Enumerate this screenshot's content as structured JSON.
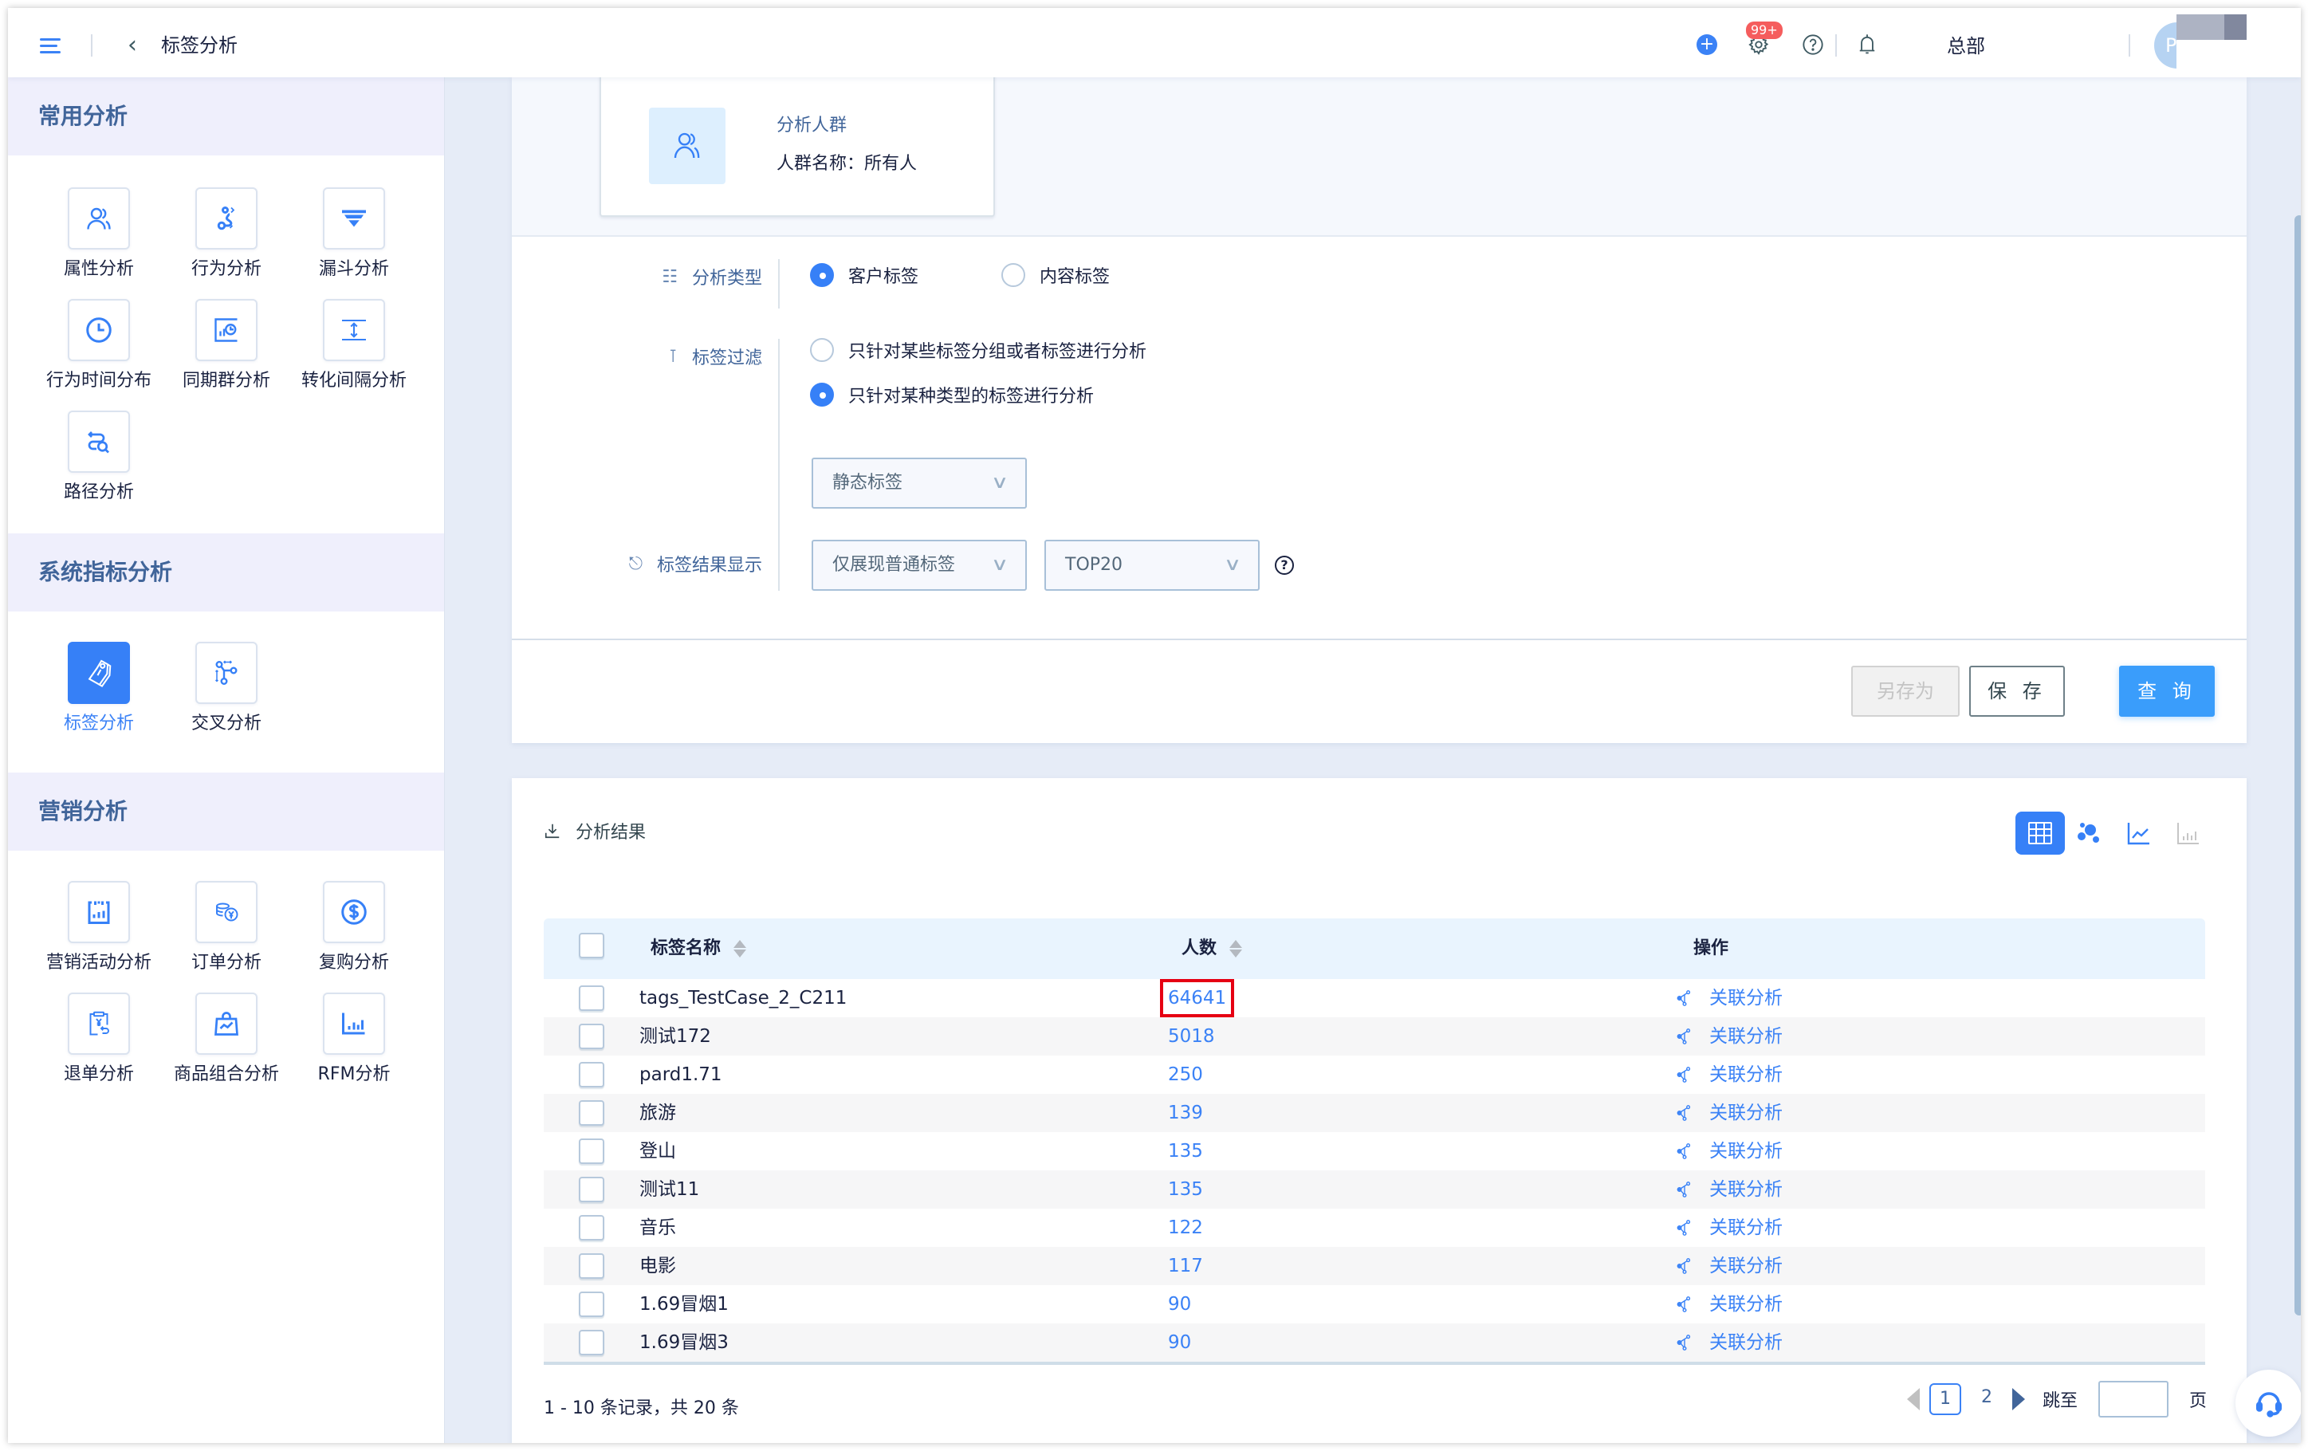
{
  "header": {
    "title": "标签分析",
    "org": "总部",
    "notification_badge": "99+",
    "avatar_initial": "P"
  },
  "sidebar": {
    "sections": [
      {
        "title": "常用分析",
        "items": [
          {
            "label": "属性分析",
            "icon": "users-icon"
          },
          {
            "label": "行为分析",
            "icon": "behavior-path-icon"
          },
          {
            "label": "漏斗分析",
            "icon": "funnel-icon"
          },
          {
            "label": "行为时间分布",
            "icon": "clock-icon"
          },
          {
            "label": "同期群分析",
            "icon": "cohort-chart-icon"
          },
          {
            "label": "转化间隔分析",
            "icon": "interval-icon"
          },
          {
            "label": "路径分析",
            "icon": "path-search-icon"
          }
        ]
      },
      {
        "title": "系统指标分析",
        "items": [
          {
            "label": "标签分析",
            "icon": "tag-icon",
            "active": true
          },
          {
            "label": "交叉分析",
            "icon": "cross-analysis-icon"
          }
        ]
      },
      {
        "title": "营销分析",
        "items": [
          {
            "label": "营销活动分析",
            "icon": "campaign-calendar-icon"
          },
          {
            "label": "订单分析",
            "icon": "coins-yen-icon"
          },
          {
            "label": "复购分析",
            "icon": "dollar-circle-icon"
          },
          {
            "label": "退单分析",
            "icon": "refund-clipboard-icon"
          },
          {
            "label": "商品组合分析",
            "icon": "shopping-bag-icon"
          },
          {
            "label": "RFM分析",
            "icon": "bar-chart-icon"
          }
        ]
      }
    ]
  },
  "crowd": {
    "title": "分析人群",
    "name": "人群名称：所有人"
  },
  "form": {
    "analysis_type": {
      "label": "分析类型",
      "options": [
        {
          "label": "客户标签",
          "checked": true
        },
        {
          "label": "内容标签",
          "checked": false
        }
      ]
    },
    "tag_filter": {
      "label": "标签过滤",
      "options": [
        {
          "label": "只针对某些标签分组或者标签进行分析",
          "checked": false
        },
        {
          "label": "只针对某种类型的标签进行分析",
          "checked": true
        }
      ],
      "type_select": "静态标签"
    },
    "result_display": {
      "label": "标签结果显示",
      "display_select": "仅展现普通标签",
      "top_select": "TOP20"
    }
  },
  "actions": {
    "save_as": "另存为",
    "save": "保 存",
    "query": "查 询"
  },
  "results": {
    "title": "分析结果",
    "view_modes": [
      "table",
      "bubble",
      "line",
      "bar"
    ],
    "active_view": "table",
    "columns": {
      "name": "标签名称",
      "count": "人数",
      "operation": "操作"
    },
    "rows": [
      {
        "name": "tags_TestCase_2_C211",
        "count": "64641",
        "action": "关联分析",
        "highlighted": true
      },
      {
        "name": "测试172",
        "count": "5018",
        "action": "关联分析"
      },
      {
        "name": "pard1.71",
        "count": "250",
        "action": "关联分析"
      },
      {
        "name": "旅游",
        "count": "139",
        "action": "关联分析"
      },
      {
        "name": "登山",
        "count": "135",
        "action": "关联分析"
      },
      {
        "name": "测试11",
        "count": "135",
        "action": "关联分析"
      },
      {
        "name": "音乐",
        "count": "122",
        "action": "关联分析"
      },
      {
        "name": "电影",
        "count": "117",
        "action": "关联分析"
      },
      {
        "name": "1.69冒烟1",
        "count": "90",
        "action": "关联分析"
      },
      {
        "name": "1.69冒烟3",
        "count": "90",
        "action": "关联分析"
      }
    ],
    "pagination": {
      "summary": "1 - 10 条记录，共 20 条",
      "pages": [
        "1",
        "2"
      ],
      "current_page": "1",
      "jump_label": "跳至",
      "page_suffix": "页",
      "jump_value": ""
    }
  },
  "colors": {
    "accent": "#3680f7",
    "query_button": "#3a9dfb",
    "highlight_border": "#e60012",
    "section_header_bg": "#efeffc",
    "badge": "#f55d5d"
  }
}
